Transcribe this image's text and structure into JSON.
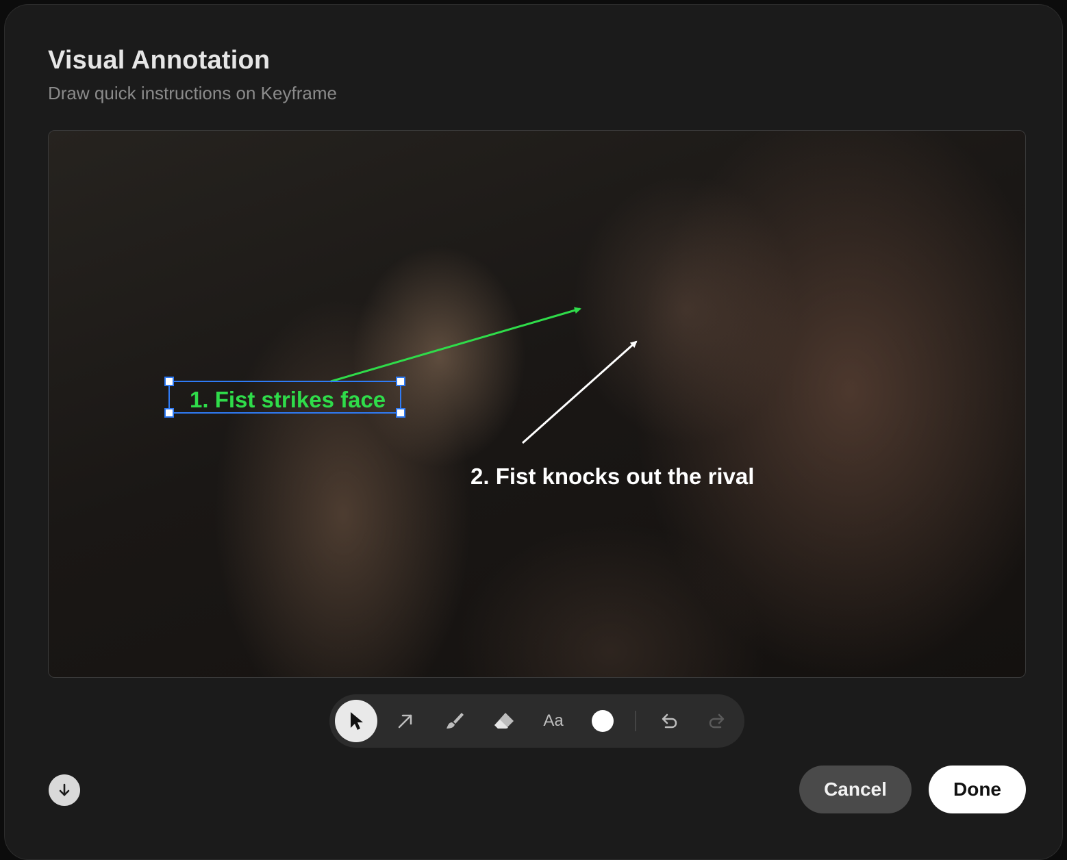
{
  "dialog": {
    "title": "Visual Annotation",
    "subtitle": "Draw quick instructions on Keyframe"
  },
  "canvas": {
    "annotations": [
      {
        "label": "1. Fist strikes face",
        "color": "#2fdc4a",
        "selected": true
      },
      {
        "label": "2. Fist knocks out the rival",
        "color": "#ffffff",
        "selected": false
      }
    ],
    "selection_color": "#2f7bf5"
  },
  "toolbar": {
    "tools": [
      {
        "name": "select",
        "icon": "cursor-icon",
        "active": true
      },
      {
        "name": "arrow",
        "icon": "arrow-icon",
        "active": false
      },
      {
        "name": "brush",
        "icon": "brush-icon",
        "active": false
      },
      {
        "name": "eraser",
        "icon": "eraser-icon",
        "active": false
      },
      {
        "name": "text",
        "icon": "text-icon",
        "label": "Aa",
        "active": false
      },
      {
        "name": "color",
        "icon": "color-swatch",
        "value": "#ffffff"
      }
    ],
    "text_tool_label": "Aa",
    "undo_enabled": true,
    "redo_enabled": false
  },
  "footer": {
    "download_icon": "download-icon",
    "cancel_label": "Cancel",
    "done_label": "Done"
  }
}
